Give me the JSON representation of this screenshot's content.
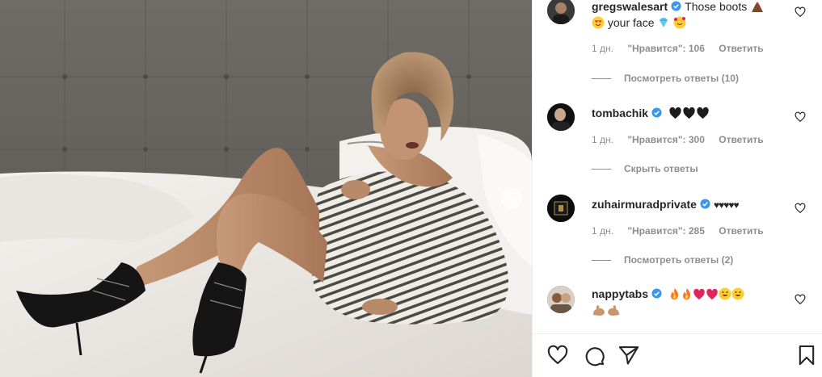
{
  "post": {
    "image_alt": "Photo of a woman in a striped shirt and black boots lounging on a bed"
  },
  "comments": [
    {
      "username": "gregswalesart",
      "verified": true,
      "text_line1": "Those boots",
      "text_line2": "your face",
      "emojis": [
        "volcano",
        "heart-eyes",
        "diamond",
        "smiling-hearts"
      ],
      "timestamp": "1 дн.",
      "likes": "\"Нравится\": 106",
      "reply": "Ответить",
      "replies_toggle": "Посмотреть ответы (10)"
    },
    {
      "username": "tombachik",
      "verified": true,
      "emojis": [
        "black-heart",
        "black-heart",
        "black-heart"
      ],
      "timestamp": "1 дн.",
      "likes": "\"Нравится\": 300",
      "reply": "Ответить",
      "replies_toggle": "Скрыть ответы"
    },
    {
      "username": "zuhairmuradprivate",
      "verified": true,
      "text": "♥♥♥♥♥",
      "timestamp": "1 дн.",
      "likes": "\"Нравится\": 285",
      "reply": "Ответить",
      "replies_toggle": "Посмотреть ответы (2)"
    },
    {
      "username": "nappytabs",
      "verified": true,
      "emojis": [
        "fire",
        "fire",
        "red-heart",
        "red-heart",
        "grinning",
        "grinning",
        "flexed-biceps",
        "flexed-biceps"
      ]
    }
  ],
  "actions": {
    "like_icon": "heart-outline-icon",
    "comment_icon": "comment-icon",
    "share_icon": "paper-plane-icon",
    "save_icon": "bookmark-icon"
  },
  "colors": {
    "verified_blue": "#3897f0",
    "meta_gray": "#8e8e8e",
    "text": "#262626"
  }
}
